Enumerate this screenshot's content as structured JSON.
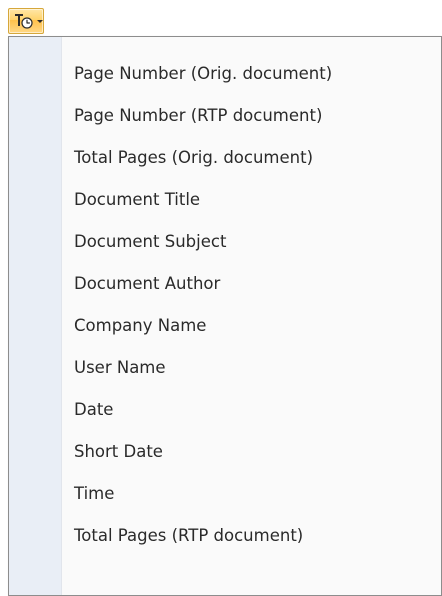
{
  "toolbar": {
    "field_button": {
      "icon": "text-field-icon",
      "dropdown_icon": "chevron-down-icon",
      "accent": "#ffd36b",
      "border": "#d6a73a"
    }
  },
  "menu": {
    "items": [
      {
        "label": "Page Number (Orig. document)"
      },
      {
        "label": "Page Number (RTP document)"
      },
      {
        "label": "Total Pages (Orig. document)"
      },
      {
        "label": "Document Title"
      },
      {
        "label": "Document Subject"
      },
      {
        "label": "Document Author"
      },
      {
        "label": "Company Name"
      },
      {
        "label": "User Name"
      },
      {
        "label": "Date"
      },
      {
        "label": "Short Date"
      },
      {
        "label": "Time"
      },
      {
        "label": "Total Pages (RTP document)"
      }
    ]
  }
}
